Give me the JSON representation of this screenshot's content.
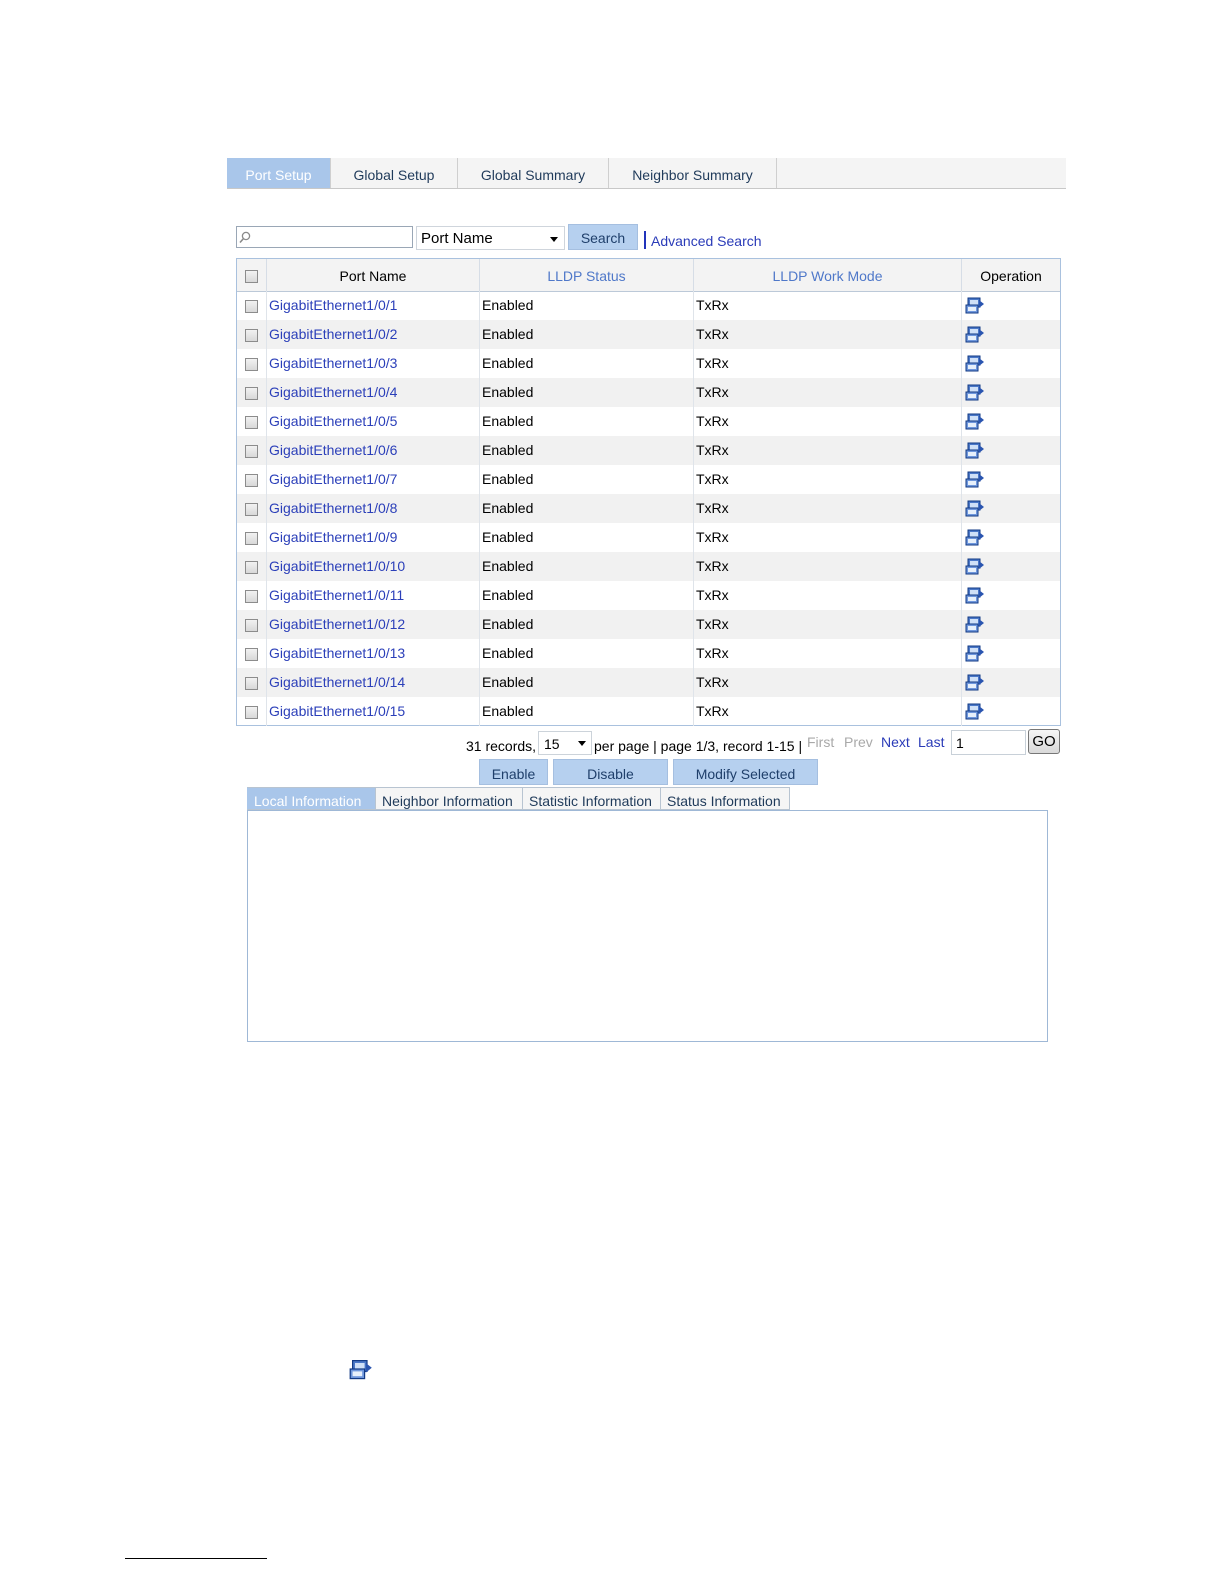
{
  "top_tabs": [
    "Port Setup",
    "Global Setup",
    "Global Summary",
    "Neighbor Summary"
  ],
  "search": {
    "value": "",
    "field": "Port Name",
    "button": "Search",
    "advanced": "Advanced Search"
  },
  "table": {
    "headers": [
      "Port Name",
      "LLDP Status",
      "LLDP Work Mode",
      "Operation"
    ],
    "rows": [
      {
        "port": "GigabitEthernet1/0/1",
        "status": "Enabled",
        "mode": "TxRx"
      },
      {
        "port": "GigabitEthernet1/0/2",
        "status": "Enabled",
        "mode": "TxRx"
      },
      {
        "port": "GigabitEthernet1/0/3",
        "status": "Enabled",
        "mode": "TxRx"
      },
      {
        "port": "GigabitEthernet1/0/4",
        "status": "Enabled",
        "mode": "TxRx"
      },
      {
        "port": "GigabitEthernet1/0/5",
        "status": "Enabled",
        "mode": "TxRx"
      },
      {
        "port": "GigabitEthernet1/0/6",
        "status": "Enabled",
        "mode": "TxRx"
      },
      {
        "port": "GigabitEthernet1/0/7",
        "status": "Enabled",
        "mode": "TxRx"
      },
      {
        "port": "GigabitEthernet1/0/8",
        "status": "Enabled",
        "mode": "TxRx"
      },
      {
        "port": "GigabitEthernet1/0/9",
        "status": "Enabled",
        "mode": "TxRx"
      },
      {
        "port": "GigabitEthernet1/0/10",
        "status": "Enabled",
        "mode": "TxRx"
      },
      {
        "port": "GigabitEthernet1/0/11",
        "status": "Enabled",
        "mode": "TxRx"
      },
      {
        "port": "GigabitEthernet1/0/12",
        "status": "Enabled",
        "mode": "TxRx"
      },
      {
        "port": "GigabitEthernet1/0/13",
        "status": "Enabled",
        "mode": "TxRx"
      },
      {
        "port": "GigabitEthernet1/0/14",
        "status": "Enabled",
        "mode": "TxRx"
      },
      {
        "port": "GigabitEthernet1/0/15",
        "status": "Enabled",
        "mode": "TxRx"
      }
    ],
    "operation_icon": "modify-icon"
  },
  "pager": {
    "records": "31 records,",
    "per_page": "15",
    "summary": "per page | page 1/3, record 1-15 |",
    "first": "First",
    "prev": "Prev",
    "next": "Next",
    "last": "Last",
    "goto_value": "1",
    "go": "GO"
  },
  "actions": {
    "enable": "Enable",
    "disable": "Disable",
    "modify": "Modify Selected"
  },
  "info_tabs": [
    "Local Information",
    "Neighbor Information",
    "Statistic Information",
    "Status Information"
  ],
  "colors": {
    "active_tab": "#a9c6ea",
    "link": "#2a3bb8",
    "button": "#b6d0ef"
  }
}
